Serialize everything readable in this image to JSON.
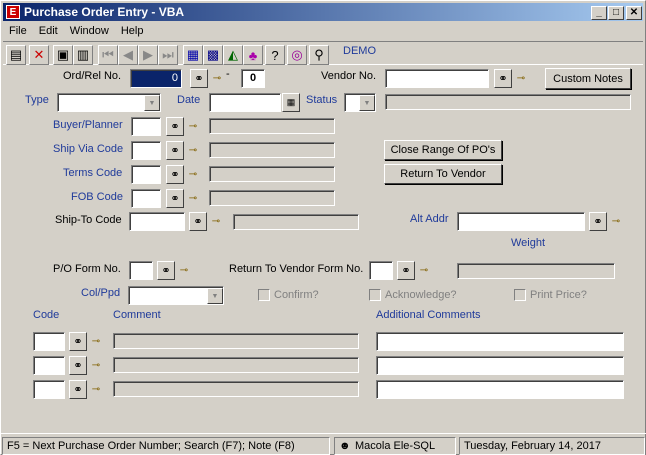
{
  "window": {
    "title": "Purchase Order Entry - VBA",
    "app_icon": "E",
    "min": "_",
    "max": "□",
    "close": "✕"
  },
  "menu": [
    "File",
    "Edit",
    "Window",
    "Help"
  ],
  "toolbar": {
    "company": "DEMO"
  },
  "labels": {
    "ord_rel": "Ord/Rel No.",
    "vendor_no": "Vendor No.",
    "type": "Type",
    "date": "Date",
    "status": "Status",
    "buyer": "Buyer/Planner",
    "ship_via": "Ship Via Code",
    "terms": "Terms Code",
    "fob": "FOB Code",
    "ship_to": "Ship-To Code",
    "alt_addr": "Alt Addr",
    "weight": "Weight",
    "po_form": "P/O Form No.",
    "rtv_form": "Return To Vendor Form No.",
    "col_ppd": "Col/Ppd",
    "confirm": "Confirm?",
    "acknowledge": "Acknowledge?",
    "print_price": "Print Price?",
    "code": "Code",
    "comment": "Comment",
    "additional": "Additional Comments"
  },
  "fields": {
    "ord_rel_value": "0",
    "release_value": "0",
    "dash": "-"
  },
  "buttons": {
    "custom_notes": "Custom Notes",
    "close_range": "Close Range Of PO's",
    "return_vendor": "Return To Vendor"
  },
  "status": {
    "hint": "F5 = Next Purchase Order Number; Search (F7); Note (F8)",
    "user": "Macola Ele-SQL",
    "date": "Tuesday, February 14, 2017"
  }
}
